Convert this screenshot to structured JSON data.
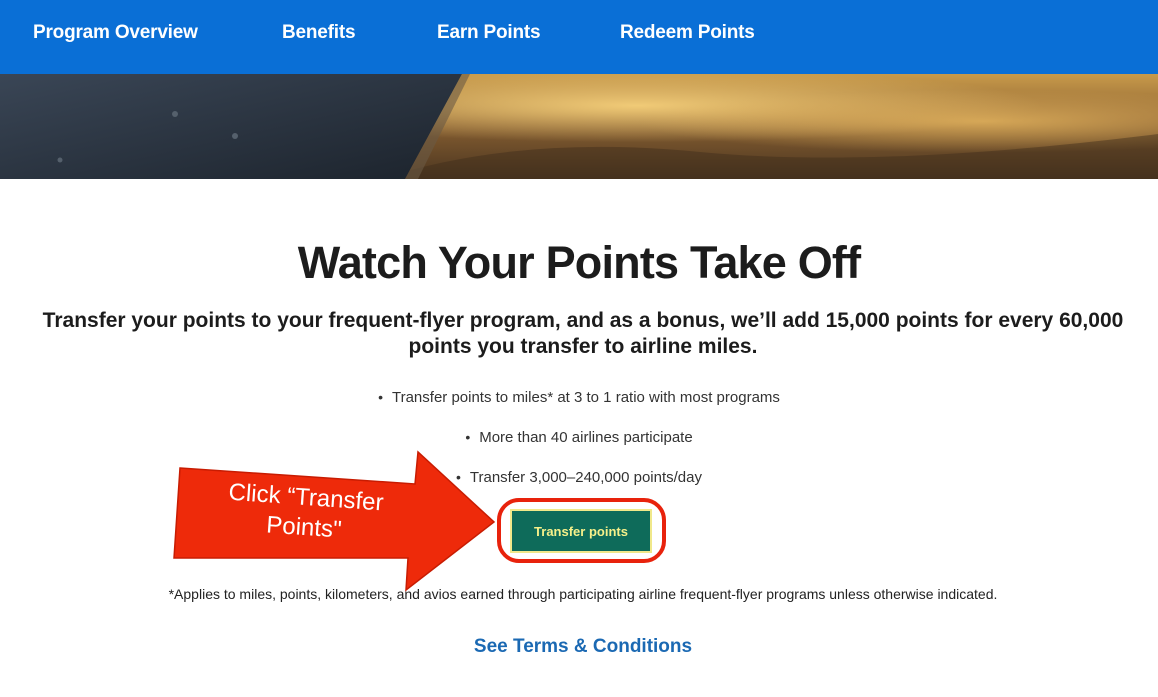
{
  "nav": {
    "items": [
      {
        "label": "Program Overview"
      },
      {
        "label": "Benefits"
      },
      {
        "label": "Earn Points"
      },
      {
        "label": "Redeem Points"
      }
    ]
  },
  "main": {
    "title": "Watch Your Points Take Off",
    "subtitle": "Transfer your points to your frequent-flyer program, and as a bonus, we’ll add 15,000 points for every 60,000 points you transfer to airline miles.",
    "bullets": [
      "Transfer points to miles* at 3 to 1 ratio with most programs",
      "More than 40 airlines participate",
      "Transfer 3,000–240,000 points/day"
    ],
    "transfer_button_label": "Transfer points",
    "footnote": "*Applies to miles, points, kilometers, and avios earned through participating airline frequent-flyer programs unless otherwise indicated.",
    "terms_link": "See Terms & Conditions"
  },
  "annotation": {
    "callout_text": "Click “Transfer Points\""
  },
  "colors": {
    "nav_bg": "#0a6fd6",
    "button_bg": "#0e6b5a",
    "button_text": "#f6f08a",
    "highlight": "#e8220c",
    "link": "#1b69b3"
  }
}
